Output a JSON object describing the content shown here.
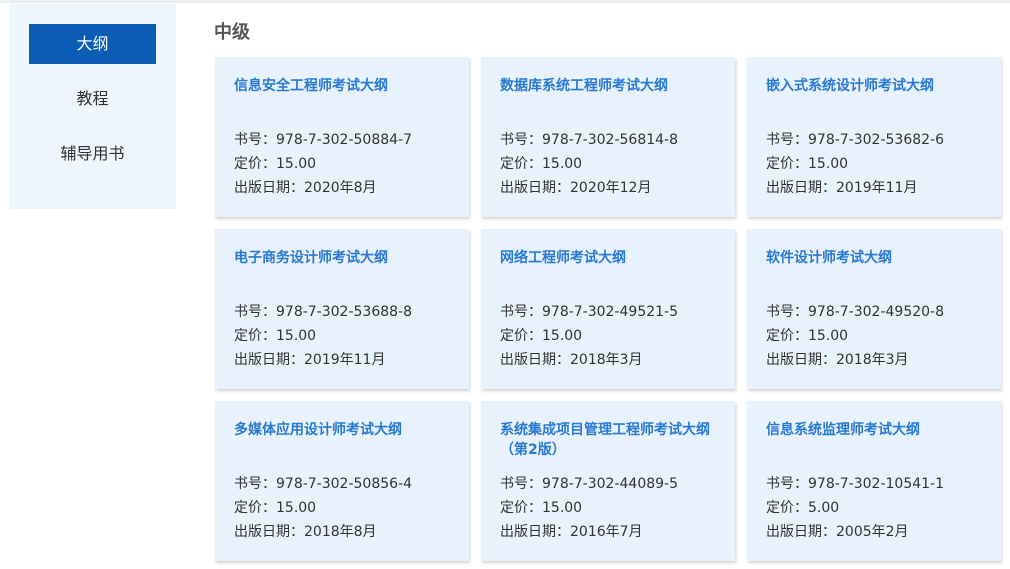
{
  "sidebar": {
    "items": [
      {
        "label": "大纲"
      },
      {
        "label": "教程"
      },
      {
        "label": "辅导用书"
      }
    ]
  },
  "section": {
    "title": "中级"
  },
  "labels": {
    "isbn": "书号：",
    "price": "定价：",
    "date": "出版日期："
  },
  "books": [
    {
      "title": "信息安全工程师考试大纲",
      "isbn": "978-7-302-50884-7",
      "price": "15.00",
      "date": "2020年8月"
    },
    {
      "title": "数据库系统工程师考试大纲",
      "isbn": "978-7-302-56814-8",
      "price": "15.00",
      "date": "2020年12月"
    },
    {
      "title": "嵌入式系统设计师考试大纲",
      "isbn": "978-7-302-53682-6",
      "price": "15.00",
      "date": "2019年11月"
    },
    {
      "title": "电子商务设计师考试大纲",
      "isbn": "978-7-302-53688-8",
      "price": "15.00",
      "date": "2019年11月"
    },
    {
      "title": "网络工程师考试大纲",
      "isbn": "978-7-302-49521-5",
      "price": "15.00",
      "date": "2018年3月"
    },
    {
      "title": "软件设计师考试大纲",
      "isbn": "978-7-302-49520-8",
      "price": "15.00",
      "date": "2018年3月"
    },
    {
      "title": "多媒体应用设计师考试大纲",
      "isbn": "978-7-302-50856-4",
      "price": "15.00",
      "date": "2018年8月"
    },
    {
      "title": "系统集成项目管理工程师考试大纲（第2版）",
      "isbn": "978-7-302-44089-5",
      "price": "15.00",
      "date": "2016年7月"
    },
    {
      "title": "信息系统监理师考试大纲",
      "isbn": "978-7-302-10541-1",
      "price": "5.00",
      "date": "2005年2月"
    }
  ]
}
